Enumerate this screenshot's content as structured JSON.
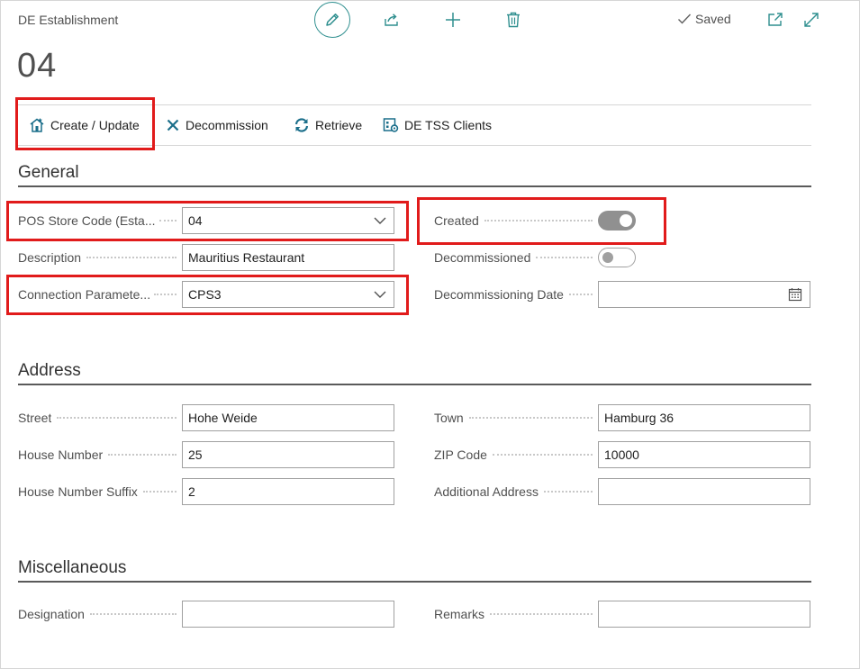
{
  "header": {
    "caption": "DE Establishment",
    "title": "04",
    "saved_label": "Saved"
  },
  "actions": [
    {
      "label": "Create / Update",
      "icon": "create-update-icon"
    },
    {
      "label": "Decommission",
      "icon": "close-icon"
    },
    {
      "label": "Retrieve",
      "icon": "refresh-icon"
    },
    {
      "label": "DE TSS Clients",
      "icon": "tss-clients-icon"
    }
  ],
  "general": {
    "heading": "General",
    "pos_store_code": {
      "label": "POS Store Code (Esta...",
      "value": "04"
    },
    "description": {
      "label": "Description",
      "value": "Mauritius Restaurant"
    },
    "connection_parameter": {
      "label": "Connection Paramete...",
      "value": "CPS3"
    },
    "created": {
      "label": "Created",
      "value": true
    },
    "decommissioned": {
      "label": "Decommissioned",
      "value": false
    },
    "decommissioning_date": {
      "label": "Decommissioning Date",
      "value": ""
    }
  },
  "address": {
    "heading": "Address",
    "street": {
      "label": "Street",
      "value": "Hohe Weide"
    },
    "house_number": {
      "label": "House Number",
      "value": "25"
    },
    "house_number_suffix": {
      "label": "House Number Suffix",
      "value": "2"
    },
    "town": {
      "label": "Town",
      "value": "Hamburg 36"
    },
    "zip_code": {
      "label": "ZIP Code",
      "value": "10000"
    },
    "additional_address": {
      "label": "Additional Address",
      "value": ""
    }
  },
  "misc": {
    "heading": "Miscellaneous",
    "designation": {
      "label": "Designation",
      "value": ""
    },
    "remarks": {
      "label": "Remarks",
      "value": ""
    }
  },
  "colors": {
    "accent": "#2f8f8f",
    "highlight": "#e11b1b",
    "action_icon": "#1a6e8a"
  }
}
